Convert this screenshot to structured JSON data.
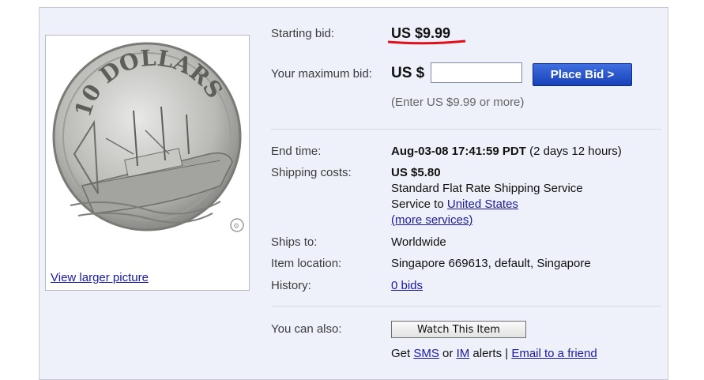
{
  "item_image": {
    "coin_text": "10 DOLLARS",
    "view_larger": "View larger picture"
  },
  "bid": {
    "starting_label": "Starting bid:",
    "starting_price": "US $9.99",
    "max_label": "Your maximum bid:",
    "currency": "US $",
    "input_value": "",
    "button": "Place Bid >",
    "hint": "(Enter US $9.99 or more)"
  },
  "details": {
    "end_time_label": "End time:",
    "end_time_value": "Aug-03-08 17:41:59 PDT",
    "end_time_remaining": "(2 days 12 hours)",
    "shipping_label": "Shipping costs:",
    "shipping_cost": "US $5.80",
    "shipping_service": "Standard Flat Rate Shipping Service",
    "service_to": "Service to",
    "service_to_link": "United States",
    "more_services": "(more services)",
    "ships_to_label": "Ships to:",
    "ships_to_value": "Worldwide",
    "location_label": "Item location:",
    "location_value": "Singapore 669613, default, Singapore",
    "history_label": "History:",
    "history_link": "0 bids"
  },
  "also": {
    "label": "You can also:",
    "watch_button": "Watch This Item",
    "get": "Get",
    "sms": "SMS",
    "or": "or",
    "im": "IM",
    "alerts": "alerts |",
    "email": "Email to a friend"
  }
}
